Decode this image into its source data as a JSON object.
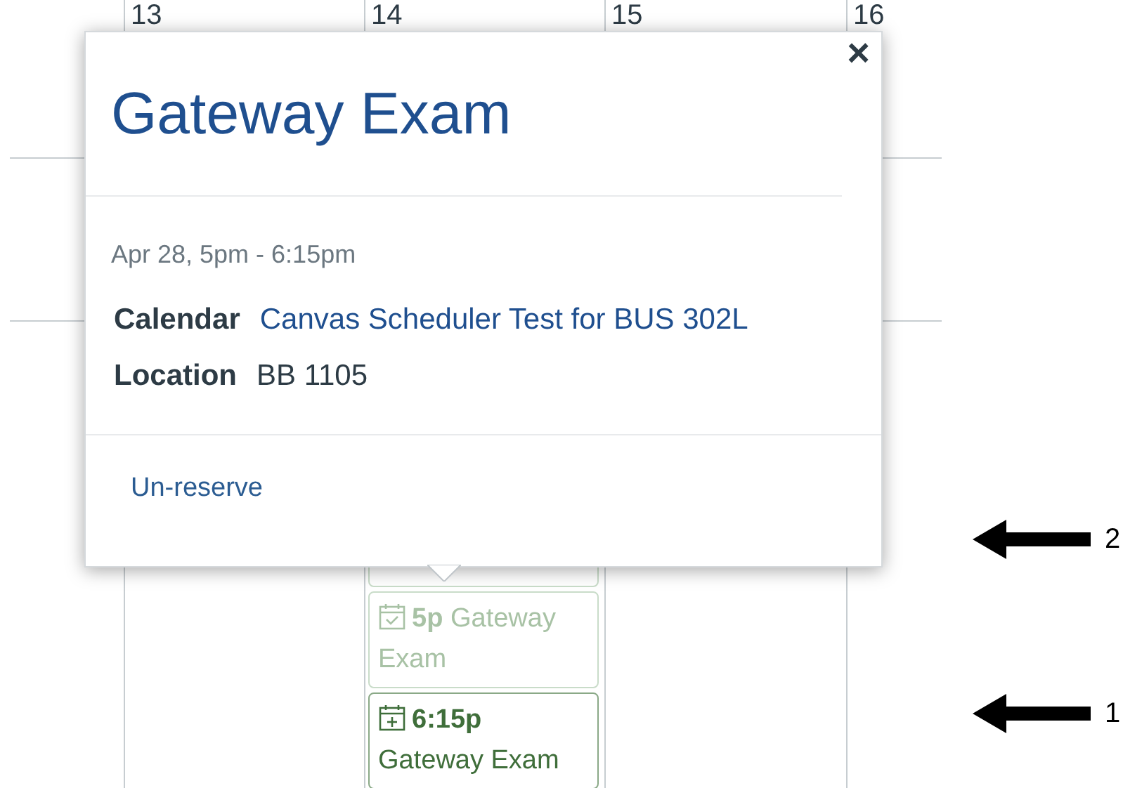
{
  "calendar": {
    "day_numbers": [
      "13",
      "14",
      "15",
      "16"
    ],
    "events": [
      {
        "time": "5p",
        "title": "Gateway Exam",
        "reserved": true
      },
      {
        "time": "6:15p",
        "title": "Gateway Exam",
        "reserved": false
      }
    ]
  },
  "popup": {
    "close": "×",
    "title": "Gateway Exam",
    "when": "Apr 28, 5pm - 6:15pm",
    "details": [
      {
        "label": "Calendar",
        "value": "Canvas Scheduler Test for BUS 302L",
        "link": true
      },
      {
        "label": "Location",
        "value": "BB 1105",
        "link": false
      }
    ],
    "action": "Un-reserve"
  },
  "annotations": [
    {
      "number": "2"
    },
    {
      "number": "1"
    }
  ]
}
